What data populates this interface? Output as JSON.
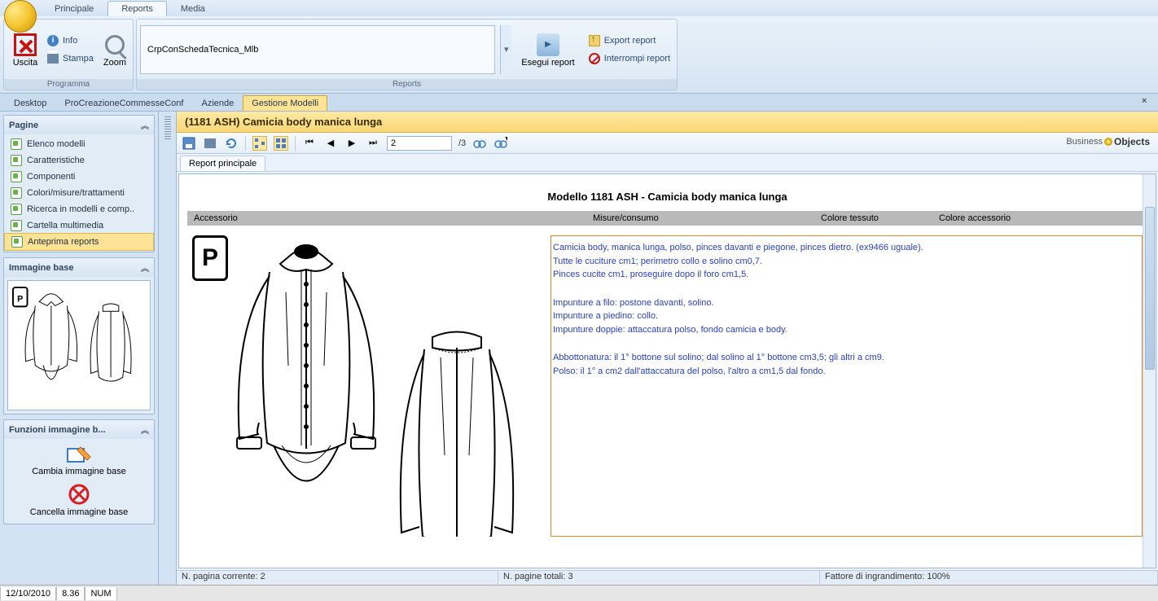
{
  "ribbon": {
    "tabs": [
      "Principale",
      "Reports",
      "Media"
    ],
    "active_tab": 1,
    "programma": {
      "label": "Programma",
      "uscita": "Uscita",
      "info": "Info",
      "stampa": "Stampa",
      "zoom": "Zoom"
    },
    "reports": {
      "label": "Reports",
      "input_value": "CrpConSchedaTecnica_Mlb",
      "esegui": "Esegui report",
      "export": "Export report",
      "interrompi": "Interrompi report"
    }
  },
  "workspace_tabs": {
    "items": [
      "Desktop",
      "ProCreazioneCommesseConf",
      "Aziende",
      "Gestione Modelli"
    ],
    "active": 3
  },
  "sidebar": {
    "pagine": {
      "title": "Pagine",
      "items": [
        "Elenco modelli",
        "Caratteristiche",
        "Componenti",
        "Colori/misure/trattamenti",
        "Ricerca in modelli e comp..",
        "Cartella multimedia",
        "Anteprima reports"
      ],
      "active": 6
    },
    "immagine_base": {
      "title": "Immagine base"
    },
    "funzioni": {
      "title": "Funzioni immagine b...",
      "cambia": "Cambia immagine base",
      "cancella": "Cancella immagine base"
    }
  },
  "document": {
    "title": "(1181 ASH) Camicia body manica lunga",
    "toolbar": {
      "page_current": "2",
      "page_total": "/3"
    },
    "subtab": "Report principale",
    "business_objects": {
      "text1": "Business",
      "text2": "Objects"
    },
    "report": {
      "header": "Modello  1181 ASH - Camicia body manica lunga",
      "columns": [
        "Accessorio",
        "Misure/consumo",
        "Colore tessuto",
        "Colore accessorio"
      ],
      "p_badge": "P",
      "desc": {
        "l1": "Camicia body, manica lunga, polso, pinces davanti e piegone, pinces dietro. (ex9466 uguale).",
        "l2": "Tutte le cuciture cm1; perimetro collo e solino cm0,7.",
        "l3": "Pinces cucite cm1, proseguire dopo il foro cm1,5.",
        "l4": "Impunture a filo: postone davanti, solino.",
        "l5": "Impunture a piedino: collo.",
        "l6": "Impunture doppie: attaccatura polso, fondo camicia e body.",
        "l7": "Abbottonatura: il 1° bottone sul solino; dal solino al 1° bottone cm3,5; gli altri a cm9.",
        "l8": "Polso: il 1° a cm2 dall'attaccatura del polso, l'altro a cm1,5 dal fondo."
      }
    },
    "status": {
      "page_current_label": "N. pagina corrente: 2",
      "page_total_label": "N. pagine totali: 3",
      "zoom_label": "Fattore di ingrandimento: 100%"
    }
  },
  "bottom_status": {
    "date": "12/10/2010",
    "time": "8.36",
    "num": "NUM"
  }
}
